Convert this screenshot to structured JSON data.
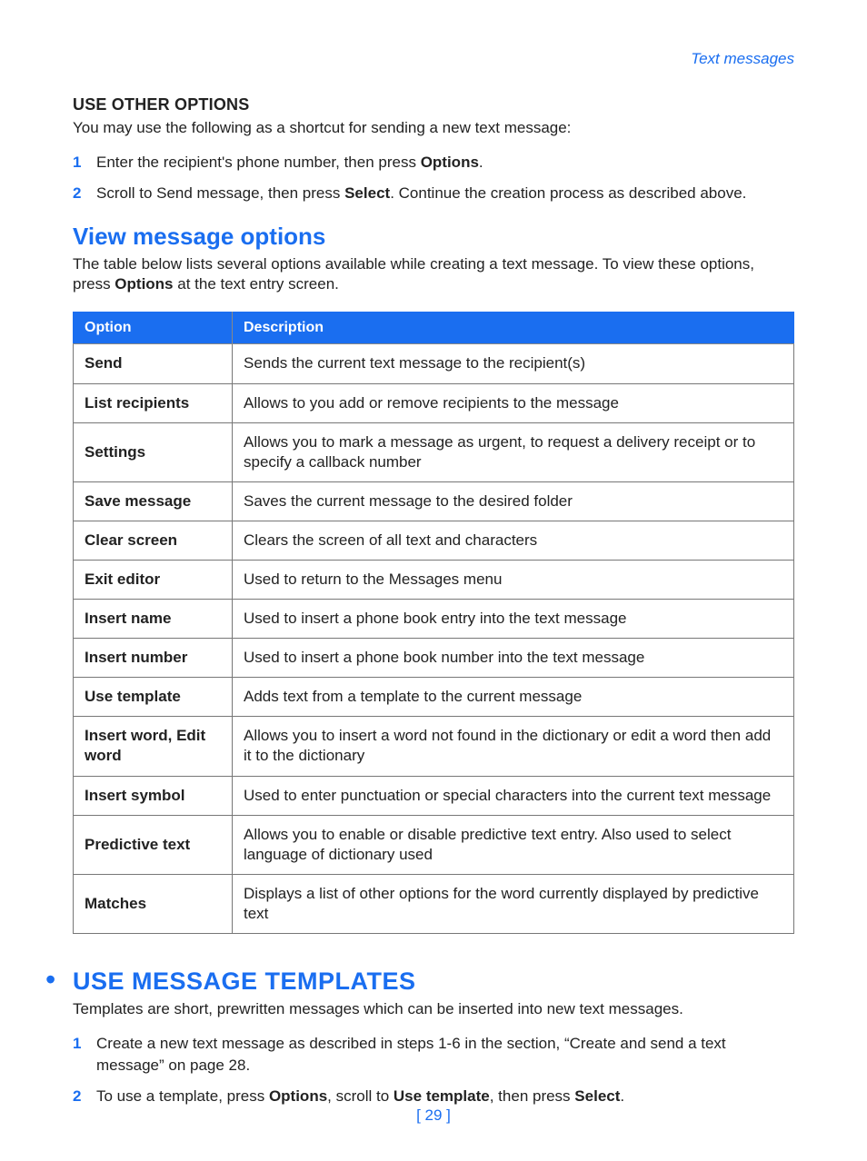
{
  "header": {
    "topic": "Text messages"
  },
  "useOther": {
    "title": "USE OTHER OPTIONS",
    "intro": "You may use the following as a shortcut for sending a new text message:",
    "steps": [
      {
        "num": "1",
        "pre": "Enter the recipient's phone number, then press ",
        "bold1": "Options",
        "post": "."
      },
      {
        "num": "2",
        "pre": "Scroll to Send message, then press ",
        "bold1": "Select",
        "post": ". Continue the creation process as described above."
      }
    ]
  },
  "viewOptions": {
    "title": "View message options",
    "intro_a": "The table below lists several options available while creating a text message. To view these options, press ",
    "intro_bold": "Options",
    "intro_b": " at the text entry screen.",
    "col1": "Option",
    "col2": "Description",
    "rows": [
      {
        "opt": "Send",
        "desc": "Sends the current text message to the recipient(s)"
      },
      {
        "opt": "List recipients",
        "desc": "Allows to you add or remove recipients to the message"
      },
      {
        "opt": "Settings",
        "desc": "Allows you to mark a message as urgent, to request a delivery receipt or to specify a callback number"
      },
      {
        "opt": "Save message",
        "desc": "Saves the current message to the desired folder"
      },
      {
        "opt": "Clear screen",
        "desc": "Clears the screen of all text and characters"
      },
      {
        "opt": "Exit editor",
        "desc": "Used to return to the Messages menu"
      },
      {
        "opt": "Insert name",
        "desc": "Used to insert a phone book entry into the text message"
      },
      {
        "opt": "Insert number",
        "desc": "Used to insert a phone book number into the text message"
      },
      {
        "opt": "Use template",
        "desc": "Adds text from a template to the current message"
      },
      {
        "opt": "Insert word, Edit word",
        "desc": "Allows you to insert a word not found in the dictionary or edit a word then add it to the dictionary"
      },
      {
        "opt": "Insert symbol",
        "desc": "Used to enter punctuation or special characters into the current text message"
      },
      {
        "opt": "Predictive text",
        "desc": "Allows you to enable or disable predictive text entry.\nAlso used to select language of dictionary used"
      },
      {
        "opt": "Matches",
        "desc": "Displays a list of other options for the word currently displayed by predictive text"
      }
    ]
  },
  "templates": {
    "title": "USE MESSAGE TEMPLATES",
    "intro": "Templates are short, prewritten messages which can be inserted into new text messages.",
    "steps": [
      {
        "num": "1",
        "text": "Create a new text message as described in steps 1-6 in the section, “Create and send a text message” on page 28."
      },
      {
        "num": "2",
        "pre": "To use a template, press ",
        "b1": "Options",
        "mid1": ", scroll to ",
        "b2": "Use template",
        "mid2": ", then press ",
        "b3": "Select",
        "post": "."
      }
    ]
  },
  "pageNumber": "[ 29 ]"
}
